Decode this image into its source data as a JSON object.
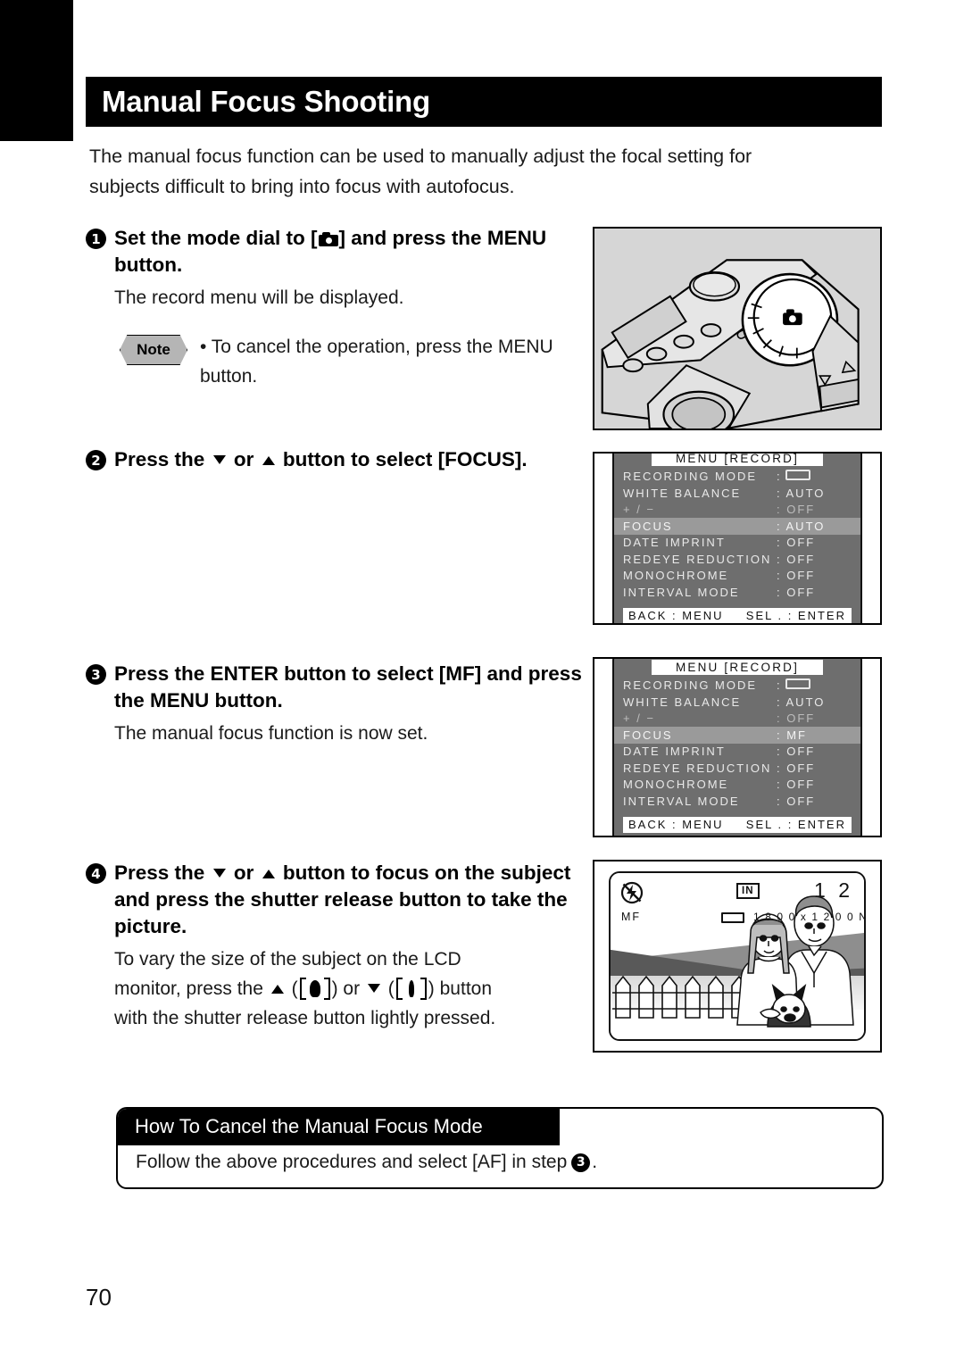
{
  "document": {
    "page_number": "70",
    "title": "Manual Focus Shooting",
    "intro": "The manual focus function can be used to manually adjust the focal setting for subjects difficult to bring into focus with autofocus."
  },
  "steps": [
    {
      "number": "1",
      "title_part1": "Set the mode dial to [",
      "title_icon": "camera-mode-icon",
      "title_part2": "] and press the MENU button.",
      "body": "The record menu will be displayed.",
      "note_label": "Note",
      "note_text": "• To cancel the operation, press the MENU button."
    },
    {
      "number": "2",
      "title_part1": "Press the",
      "icon_down": "arrow-down-icon",
      "title_or": "or",
      "icon_up": "arrow-up-icon",
      "title_part2": "button to select [FOCUS].",
      "body": ""
    },
    {
      "number": "3",
      "title_part1": "Press the ENTER button to select [MF] and press the MENU button.",
      "body": "The manual focus function is now set."
    },
    {
      "number": "4",
      "title_part1": "Press the",
      "icon_down": "arrow-down-icon",
      "title_or": "or",
      "icon_up": "arrow-up-icon",
      "title_part2": "button to focus on the subject and press the shutter release button to take the picture.",
      "body_line1": "To vary the size of the subject on the LCD",
      "body_line2_a": "monitor, press the",
      "body_line2_b": "(",
      "body_line2_c": ") or",
      "body_line2_d": "(",
      "body_line2_e": ") button",
      "body_line3": "with the shutter release button lightly pressed."
    }
  ],
  "illustrations": {
    "camera_photo": {
      "name": "camera-top-view-with-mode-dial"
    },
    "menu_auto": {
      "title": "MENU  [RECORD]",
      "rows": [
        {
          "label": "RECORDING  MODE",
          "value": ":",
          "value_icon": "image-size-box-icon",
          "state": "normal"
        },
        {
          "label": "WHITE  BALANCE",
          "value": ": AUTO",
          "state": "normal"
        },
        {
          "label": "+ / −",
          "value": ": OFF",
          "state": "dim"
        },
        {
          "label": "FOCUS",
          "value": ": AUTO",
          "state": "selected"
        },
        {
          "label": "DATE  IMPRINT",
          "value": ": OFF",
          "state": "normal"
        },
        {
          "label": "REDEYE  REDUCTION",
          "value": ": OFF",
          "state": "normal"
        },
        {
          "label": "MONOCHROME",
          "value": ": OFF",
          "state": "normal"
        },
        {
          "label": "INTERVAL  MODE",
          "value": ": OFF",
          "state": "normal"
        }
      ],
      "footer_left": "BACK : MENU",
      "footer_right": "SEL . : ENTER"
    },
    "menu_mf": {
      "title": "MENU  [RECORD]",
      "rows": [
        {
          "label": "RECORDING  MODE",
          "value": ":",
          "value_icon": "image-size-box-icon",
          "state": "normal"
        },
        {
          "label": "WHITE  BALANCE",
          "value": ": AUTO",
          "state": "normal"
        },
        {
          "label": "+ / −",
          "value": ": OFF",
          "state": "dim"
        },
        {
          "label": "FOCUS",
          "value": ": MF",
          "state": "selected"
        },
        {
          "label": "DATE  IMPRINT",
          "value": ": OFF",
          "state": "normal"
        },
        {
          "label": "REDEYE  REDUCTION",
          "value": ": OFF",
          "state": "normal"
        },
        {
          "label": "MONOCHROME",
          "value": ": OFF",
          "state": "normal"
        },
        {
          "label": "INTERVAL  MODE",
          "value": ": OFF",
          "state": "normal"
        }
      ],
      "footer_left": "BACK : MENU",
      "footer_right": "SEL . : ENTER"
    },
    "lcd_preview": {
      "flash_icon": "flash-off-icon",
      "focus_mode": "MF",
      "memory_badge": "IN",
      "shots_remaining": "1 2",
      "quality_icon": "image-size-box-icon",
      "image_size": "1 8 0 0 x 1 2 0 0   N",
      "scene": "couple-with-dog-in-front-of-fence-landscape"
    }
  },
  "cancel_section": {
    "heading": "How To Cancel the Manual Focus Mode",
    "body_before": "Follow the above procedures and select [AF] in step",
    "step_ref": "3",
    "body_after": "."
  }
}
